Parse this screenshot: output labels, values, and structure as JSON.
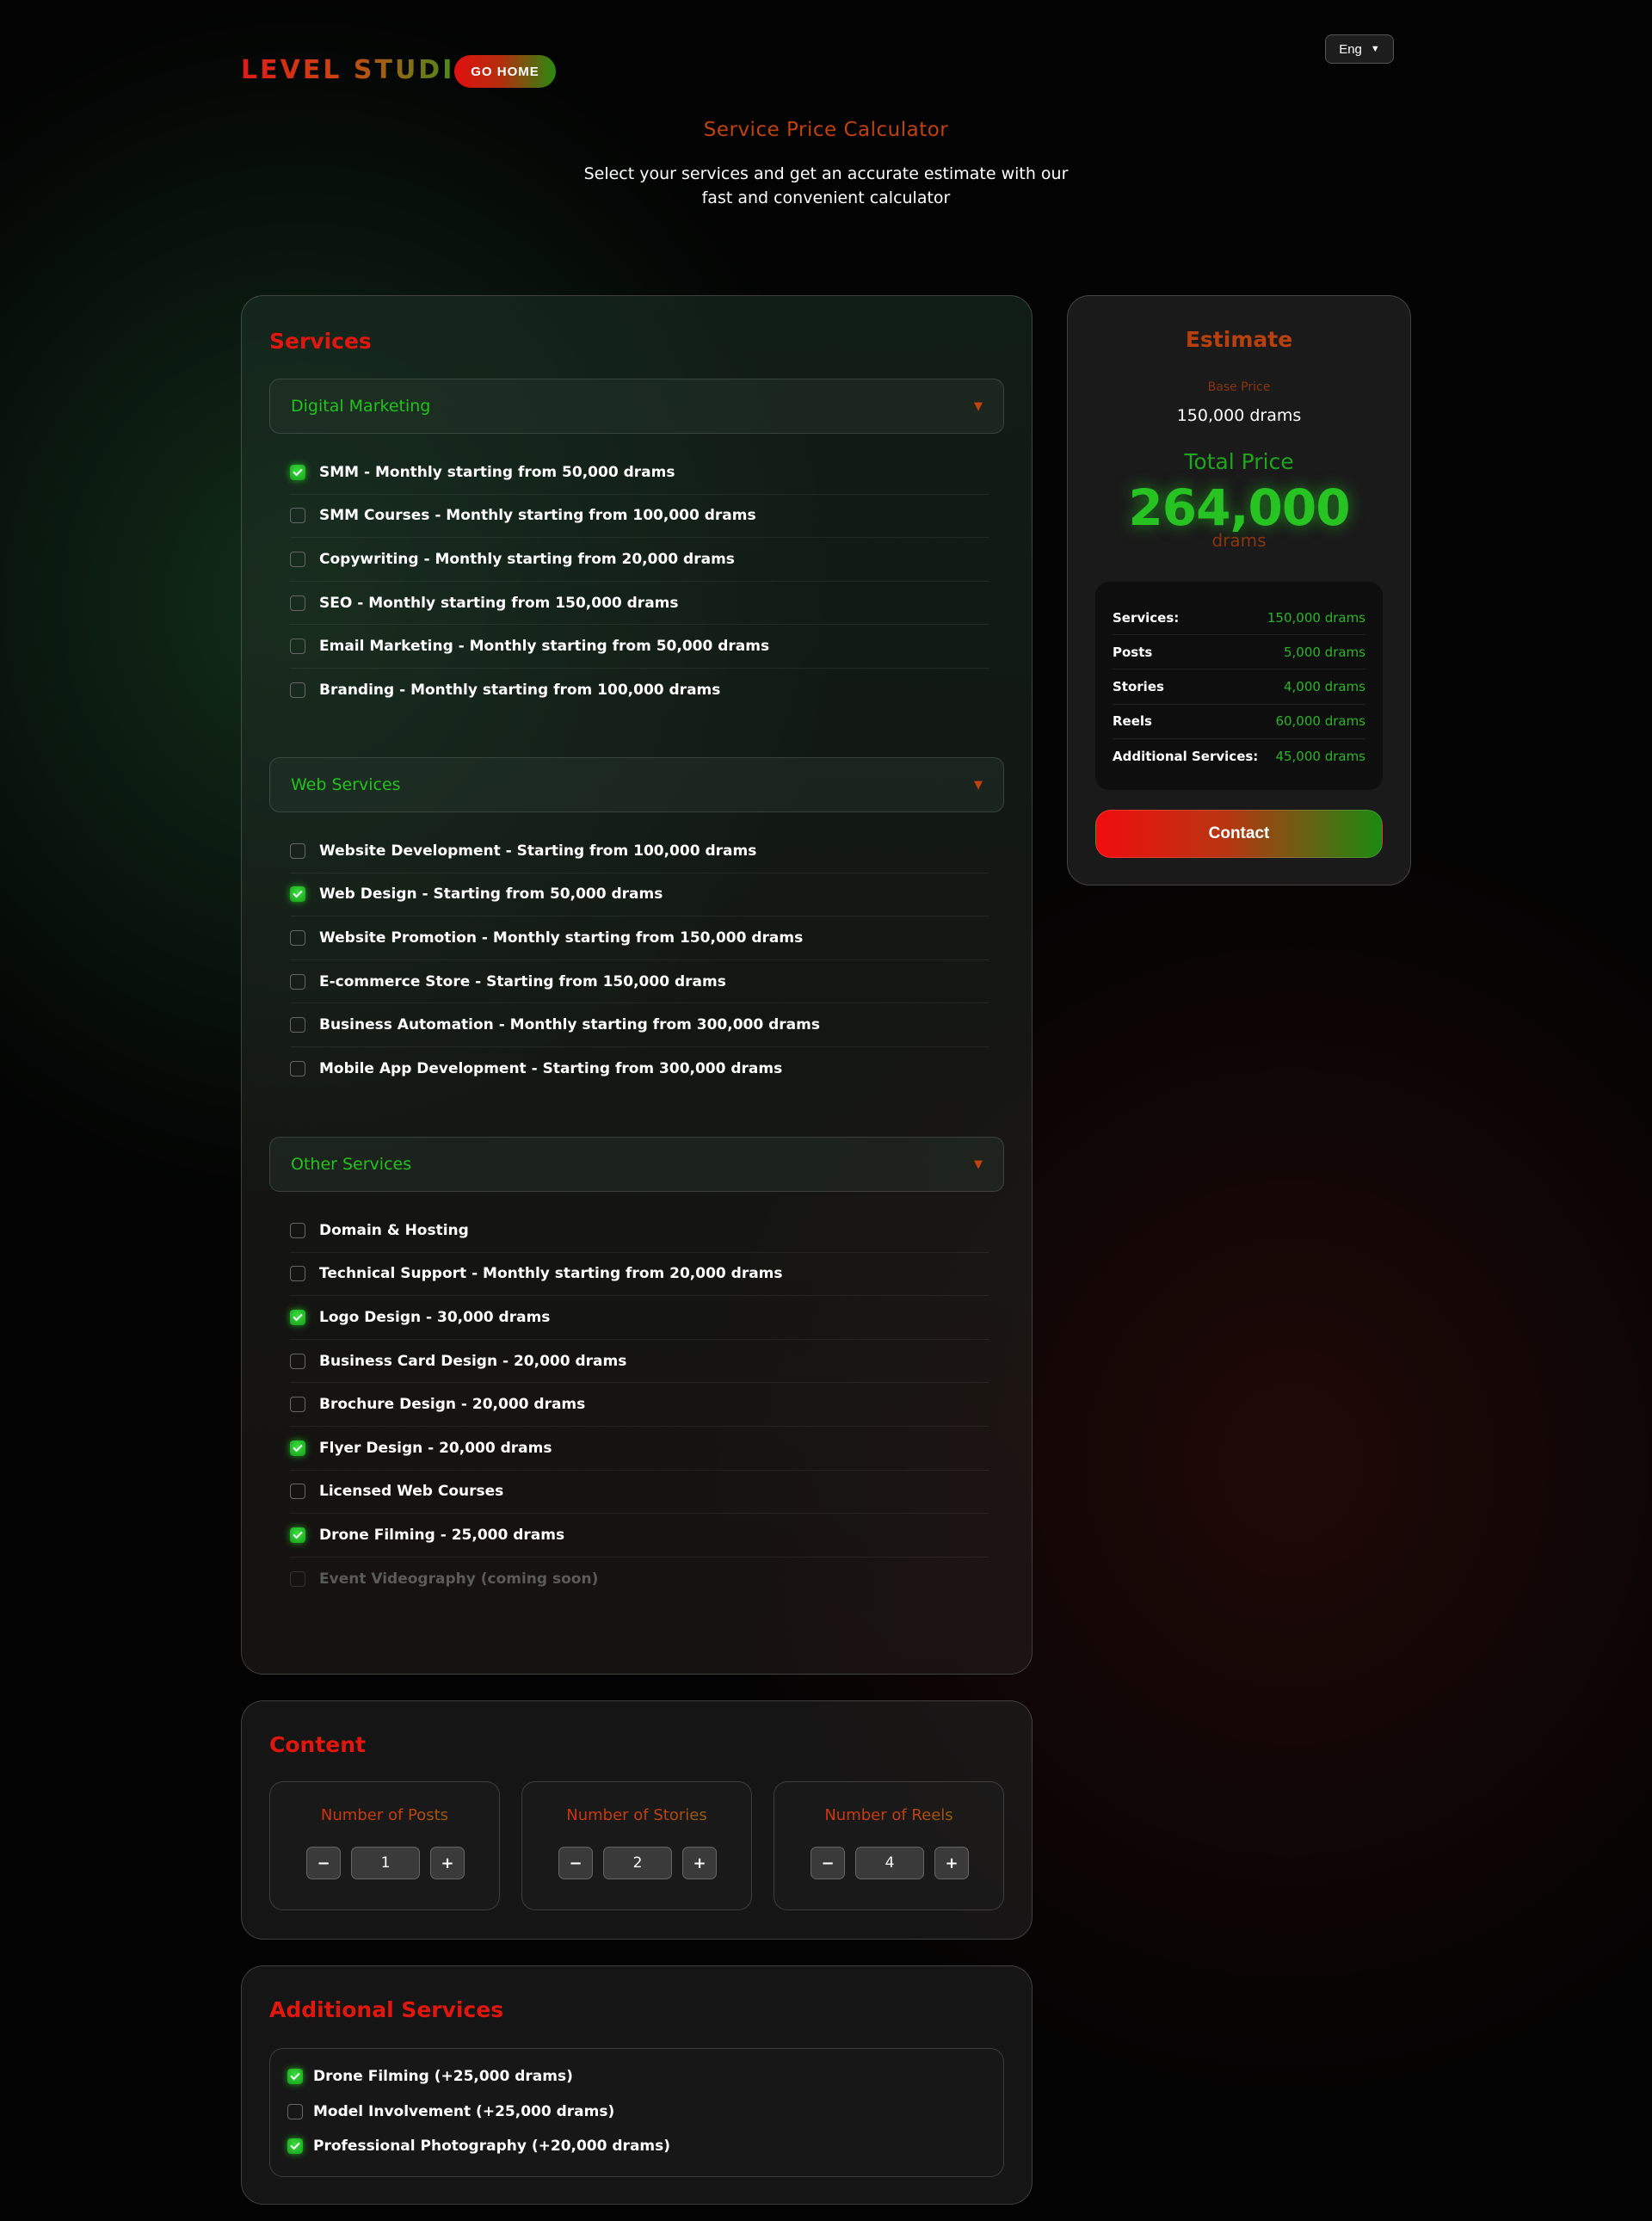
{
  "header": {
    "logo_text": "LEVEL STUDIO",
    "go_home_label": "GO HOME",
    "language": "Eng",
    "title": "Service Price Calculator",
    "subtitle": "Select your services and get an accurate estimate with our fast and convenient calculator"
  },
  "services": {
    "title": "Services",
    "groups": [
      {
        "label": "Digital Marketing",
        "options": [
          {
            "label": "SMM - Monthly starting from 50,000 drams",
            "checked": true
          },
          {
            "label": "SMM Courses - Monthly starting from 100,000 drams",
            "checked": false
          },
          {
            "label": "Copywriting - Monthly starting from 20,000 drams",
            "checked": false
          },
          {
            "label": "SEO - Monthly starting from 150,000 drams",
            "checked": false
          },
          {
            "label": "Email Marketing - Monthly starting from 50,000 drams",
            "checked": false
          },
          {
            "label": "Branding - Monthly starting from 100,000 drams",
            "checked": false
          }
        ]
      },
      {
        "label": "Web Services",
        "options": [
          {
            "label": "Website Development - Starting from 100,000 drams",
            "checked": false
          },
          {
            "label": "Web Design - Starting from 50,000 drams",
            "checked": true
          },
          {
            "label": "Website Promotion - Monthly starting from 150,000 drams",
            "checked": false
          },
          {
            "label": "E-commerce Store - Starting from 150,000 drams",
            "checked": false
          },
          {
            "label": "Business Automation - Monthly starting from 300,000 drams",
            "checked": false
          },
          {
            "label": "Mobile App Development - Starting from 300,000 drams",
            "checked": false
          }
        ]
      },
      {
        "label": "Other Services",
        "options": [
          {
            "label": "Domain & Hosting",
            "checked": false
          },
          {
            "label": "Technical Support - Monthly starting from 20,000 drams",
            "checked": false
          },
          {
            "label": "Logo Design - 30,000 drams",
            "checked": true
          },
          {
            "label": "Business Card Design - 20,000 drams",
            "checked": false
          },
          {
            "label": "Brochure Design - 20,000 drams",
            "checked": false
          },
          {
            "label": "Flyer Design - 20,000 drams",
            "checked": true
          },
          {
            "label": "Licensed Web Courses",
            "checked": false
          },
          {
            "label": "Drone Filming - 25,000 drams",
            "checked": true
          },
          {
            "label": "Event Videography (coming soon)",
            "checked": false,
            "disabled": true
          }
        ]
      }
    ]
  },
  "estimate": {
    "title": "Estimate",
    "base_label": "Base Price",
    "base_value": "150,000 drams",
    "total_label": "Total Price",
    "total_value": "264,000",
    "total_unit": "drams",
    "breakdown": [
      {
        "label": "Services:",
        "value": "150,000 drams"
      },
      {
        "label": "Posts",
        "value": "5,000 drams"
      },
      {
        "label": "Stories",
        "value": "4,000 drams"
      },
      {
        "label": "Reels",
        "value": "60,000 drams"
      },
      {
        "label": "Additional Services:",
        "value": "45,000 drams"
      }
    ],
    "contact_label": "Contact"
  },
  "content": {
    "title": "Content",
    "counters": [
      {
        "label": "Number of Posts",
        "value": "1",
        "minus": "−",
        "plus": "+"
      },
      {
        "label": "Number of Stories",
        "value": "2",
        "minus": "−",
        "plus": "+"
      },
      {
        "label": "Number of Reels",
        "value": "4",
        "minus": "−",
        "plus": "+"
      }
    ]
  },
  "additional": {
    "title": "Additional Services",
    "options": [
      {
        "label": "Drone Filming (+25,000 drams)",
        "checked": true
      },
      {
        "label": "Model Involvement (+25,000 drams)",
        "checked": false
      },
      {
        "label": "Professional Photography (+20,000 drams)",
        "checked": true
      }
    ]
  },
  "colors": {
    "accent_red": "#e0170f",
    "accent_orange": "#c1410f",
    "accent_green": "#22c21c"
  }
}
